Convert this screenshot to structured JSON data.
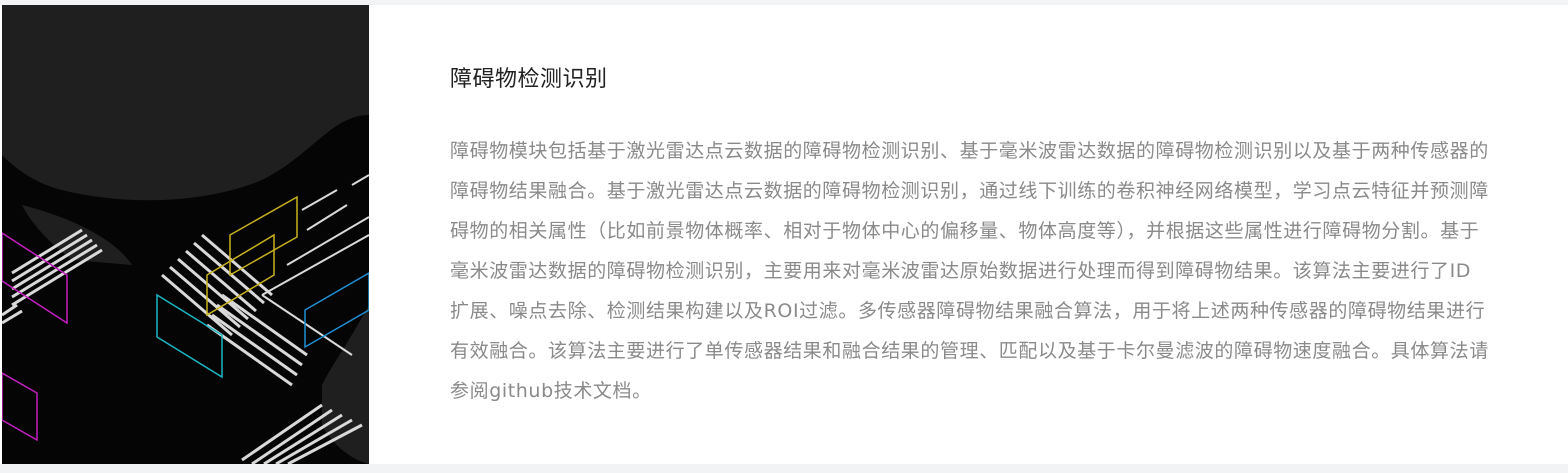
{
  "section": {
    "title": "障碍物检测识别",
    "description": "障碍物模块包括基于激光雷达点云数据的障碍物检测识别、基于毫米波雷达数据的障碍物检测识别以及基于两种传感器的障碍物结果融合。基于激光雷达点云数据的障碍物检测识别，通过线下训练的卷积神经网络模型，学习点云特征并预测障碍物的相关属性（比如前景物体概率、相对于物体中心的偏移量、物体高度等），并根据这些属性进行障碍物分割。基于毫米波雷达数据的障碍物检测识别，主要用来对毫米波雷达原始数据进行处理而得到障碍物结果。该算法主要进行了ID扩展、噪点去除、检测结果构建以及ROI过滤。多传感器障碍物结果融合算法，用于将上述两种传感器的障碍物结果进行有效融合。该算法主要进行了单传感器结果和融合结果的管理、匹配以及基于卡尔曼滤波的障碍物速度融合。具体算法请参阅github技术文档。"
  },
  "illustration": {
    "colors": {
      "background": "#050505",
      "road_surface": "#1f1f1f",
      "lane_marking": "#d9d9d9",
      "box_yellow": "#c9b21f",
      "box_cyan": "#19b8c4",
      "box_magenta": "#c41fc0",
      "box_blue": "#1f8fd1"
    }
  }
}
